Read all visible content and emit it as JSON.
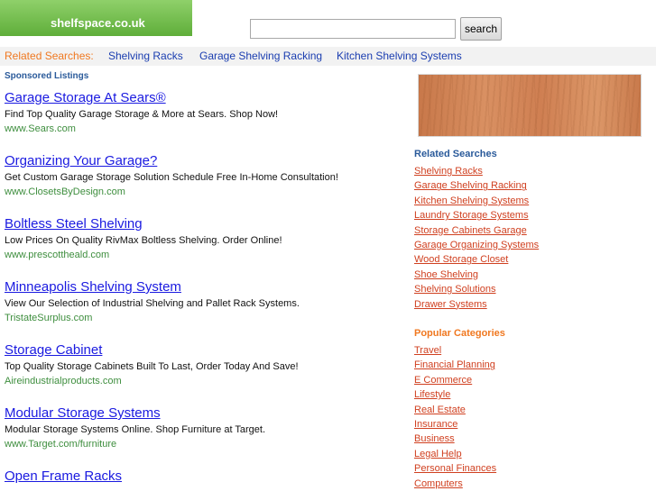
{
  "header": {
    "logo_text": "shelfspace.co.uk",
    "search_placeholder": "",
    "search_button": "search"
  },
  "top_bar": {
    "label": "Related Searches:",
    "links": [
      "Shelving Racks",
      "Garage Shelving Racking",
      "Kitchen Shelving Systems"
    ]
  },
  "sponsored_heading": "Sponsored Listings",
  "listings": [
    {
      "title": "Garage Storage At Sears®",
      "desc": "Find Top Quality Garage Storage & More at Sears. Shop Now!",
      "url": "www.Sears.com"
    },
    {
      "title": "Organizing Your Garage?",
      "desc": "Get Custom Garage Storage Solution Schedule Free In-Home Consultation!",
      "url": "www.ClosetsByDesign.com"
    },
    {
      "title": "Boltless Steel Shelving",
      "desc": "Low Prices On Quality RivMax Boltless Shelving. Order Online!",
      "url": "www.prescottheald.com"
    },
    {
      "title": "Minneapolis Shelving System",
      "desc": "View Our Selection of Industrial Shelving and Pallet Rack Systems.",
      "url": "TristateSurplus.com"
    },
    {
      "title": "Storage Cabinet",
      "desc": "Top Quality Storage Cabinets Built To Last, Order Today And Save!",
      "url": "Aireindustrialproducts.com"
    },
    {
      "title": "Modular Storage Systems",
      "desc": "Modular Storage Systems Online. Shop Furniture at Target.",
      "url": "www.Target.com/furniture"
    },
    {
      "title": "Open Frame Racks",
      "desc": "",
      "url": ""
    }
  ],
  "sidebar": {
    "related_heading": "Related Searches",
    "related": [
      "Shelving Racks",
      "Garage Shelving Racking",
      "Kitchen Shelving Systems",
      "Laundry Storage Systems",
      "Storage Cabinets Garage",
      "Garage Organizing Systems",
      "Wood Storage Closet",
      "Shoe Shelving",
      "Shelving Solutions",
      "Drawer Systems"
    ],
    "popular_heading": "Popular Categories",
    "popular": [
      "Travel",
      "Financial Planning",
      "E Commerce",
      "Lifestyle",
      "Real Estate",
      "Insurance",
      "Business",
      "Legal Help",
      "Personal Finances",
      "Computers"
    ]
  },
  "colors": {
    "logo_green": "#6fbe48",
    "link_blue": "#1a1ae0",
    "url_green": "#3e8e3e",
    "accent_orange": "#f07820",
    "side_link_red": "#d04020"
  }
}
